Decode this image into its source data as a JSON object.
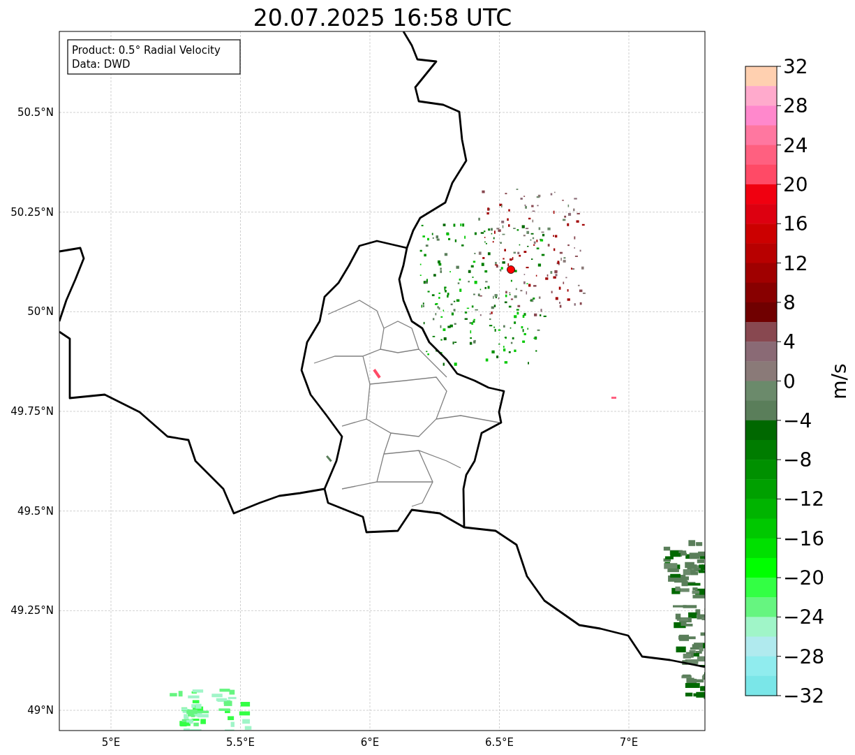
{
  "title": "20.07.2025 16:58 UTC",
  "legend": [
    "Product: 0.5° Radial Velocity",
    "Data: DWD"
  ],
  "lat_ticks": [
    "50.5°N",
    "50.25°N",
    "50°N",
    "49.75°N",
    "49.5°N",
    "49.25°N",
    "49°N"
  ],
  "lon_ticks": [
    "5°E",
    "5.5°E",
    "6°E",
    "6.5°E",
    "7°E"
  ],
  "colorbar": {
    "label": "m/s",
    "ticks": [
      "32",
      "28",
      "24",
      "20",
      "16",
      "12",
      "8",
      "4",
      "0",
      "−4",
      "−8",
      "−12",
      "−16",
      "−20",
      "−24",
      "−28",
      "−32"
    ],
    "bands": [
      {
        "color": "#ffd0b0"
      },
      {
        "color": "#ffaacc"
      },
      {
        "color": "#ff88cc"
      },
      {
        "color": "#ff77a0"
      },
      {
        "color": "#ff6080"
      },
      {
        "color": "#ff4a66"
      },
      {
        "color": "#f00010"
      },
      {
        "color": "#dd0010"
      },
      {
        "color": "#cc0000"
      },
      {
        "color": "#b80000"
      },
      {
        "color": "#a00000"
      },
      {
        "color": "#880000"
      },
      {
        "color": "#700000"
      },
      {
        "color": "#884850"
      },
      {
        "color": "#8a6a75"
      },
      {
        "color": "#8a7a78"
      },
      {
        "color": "#6b8a6b"
      },
      {
        "color": "#5a7e5a"
      },
      {
        "color": "#006800"
      },
      {
        "color": "#007c00"
      },
      {
        "color": "#009000"
      },
      {
        "color": "#00a000"
      },
      {
        "color": "#00b400"
      },
      {
        "color": "#00c800"
      },
      {
        "color": "#00e000"
      },
      {
        "color": "#00ff00"
      },
      {
        "color": "#33ff44"
      },
      {
        "color": "#66f580"
      },
      {
        "color": "#a0f5c8"
      },
      {
        "color": "#b0eaee"
      },
      {
        "color": "#90ecee"
      },
      {
        "color": "#7ae6e8"
      }
    ]
  }
}
